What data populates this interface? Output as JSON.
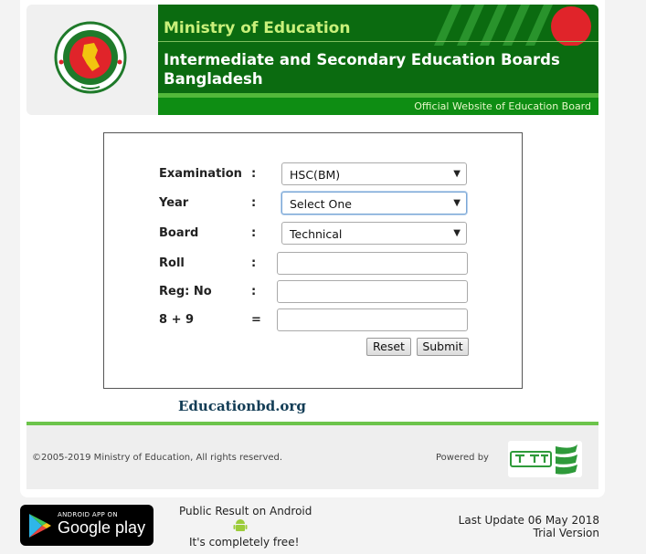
{
  "header": {
    "ministry": "Ministry of Education",
    "boards": "Intermediate and Secondary Education Boards Bangladesh",
    "official": "Official Website of Education Board"
  },
  "form": {
    "examination": {
      "label": "Examination",
      "colon": ":",
      "value": "HSC(BM)"
    },
    "year": {
      "label": "Year",
      "colon": ":",
      "value": "Select One"
    },
    "board": {
      "label": "Board",
      "colon": ":",
      "value": "Technical"
    },
    "roll": {
      "label": "Roll",
      "colon": ":",
      "value": ""
    },
    "reg": {
      "label": "Reg: No",
      "colon": ":",
      "value": ""
    },
    "captcha": {
      "label": "8 + 9",
      "colon": "=",
      "value": ""
    },
    "reset_label": "Reset",
    "submit_label": "Submit"
  },
  "site_name": "Educationbd.org",
  "footer": {
    "copyright": "©2005-2019 Ministry of Education, All rights reserved.",
    "powered_by": "Powered by"
  },
  "bottom": {
    "play_small": "ANDROID APP ON",
    "play_big": "Google play",
    "public_result": "Public Result on Android",
    "free": "It's completely free!",
    "last_update": "Last Update 06 May 2018",
    "trial": "Trial Version"
  },
  "colors": {
    "banner_green": "#0b6b10",
    "accent_green": "#6cc44b",
    "flag_red": "#e0242a"
  }
}
